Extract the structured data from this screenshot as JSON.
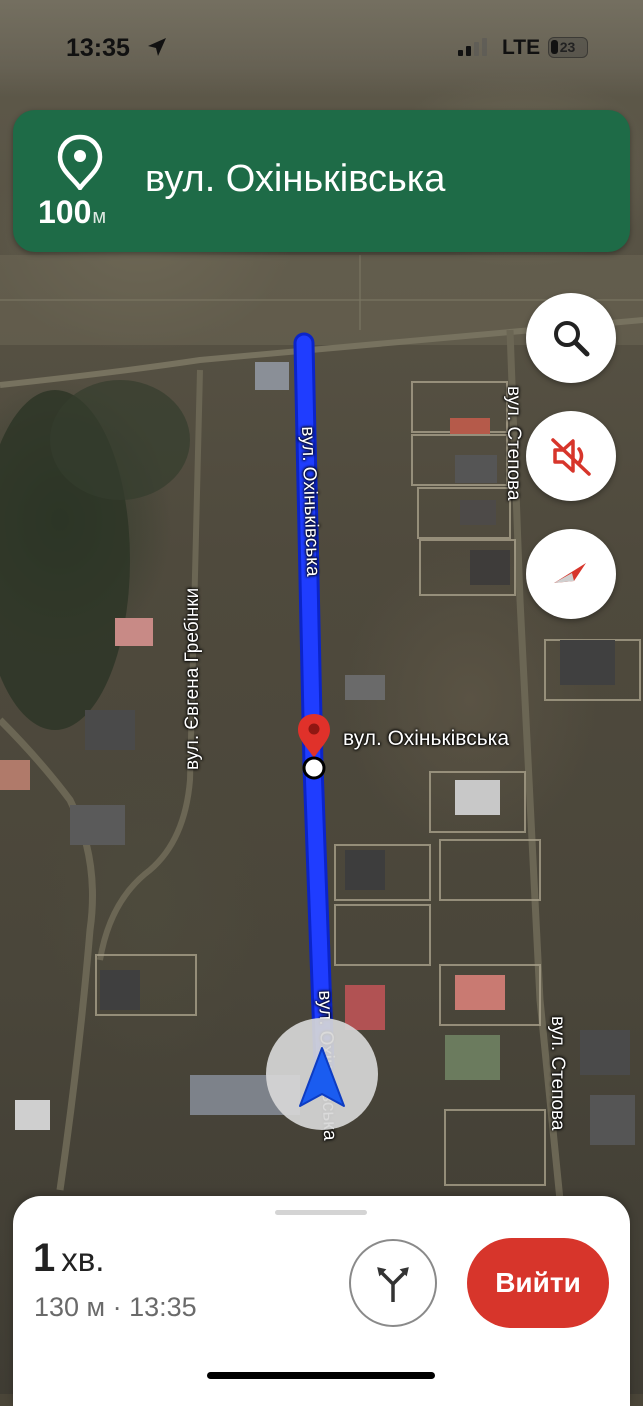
{
  "status_bar": {
    "time": "13:35",
    "network": "LTE",
    "battery": "23",
    "icons": [
      "location-arrow-icon",
      "signal-icon",
      "battery-icon"
    ]
  },
  "banner": {
    "distance": "100",
    "distance_unit": "м",
    "street": "вул. Охіньківська",
    "icon": "destination-pin-icon",
    "color": "#1e6b47"
  },
  "map": {
    "labels": {
      "route_street": "вул. Охіньківська",
      "route_street_lower": "вул. Охіньківська",
      "street_stepova_top": "вул. Степова",
      "street_stepova_bottom": "вул. Степова",
      "street_hrebinky": "вул. Євгена Гребінки",
      "destination": "вул. Охіньківська"
    },
    "route_color": "#1a3cff",
    "buttons": [
      "search-icon",
      "sound-off-icon",
      "compass-icon"
    ]
  },
  "bottom_sheet": {
    "eta_value": "1",
    "eta_unit": "хв.",
    "details": "130 м · 13:35",
    "alternate_routes_icon": "alternate-routes-icon",
    "exit_label": "Вийти",
    "exit_color": "#d7352b"
  }
}
